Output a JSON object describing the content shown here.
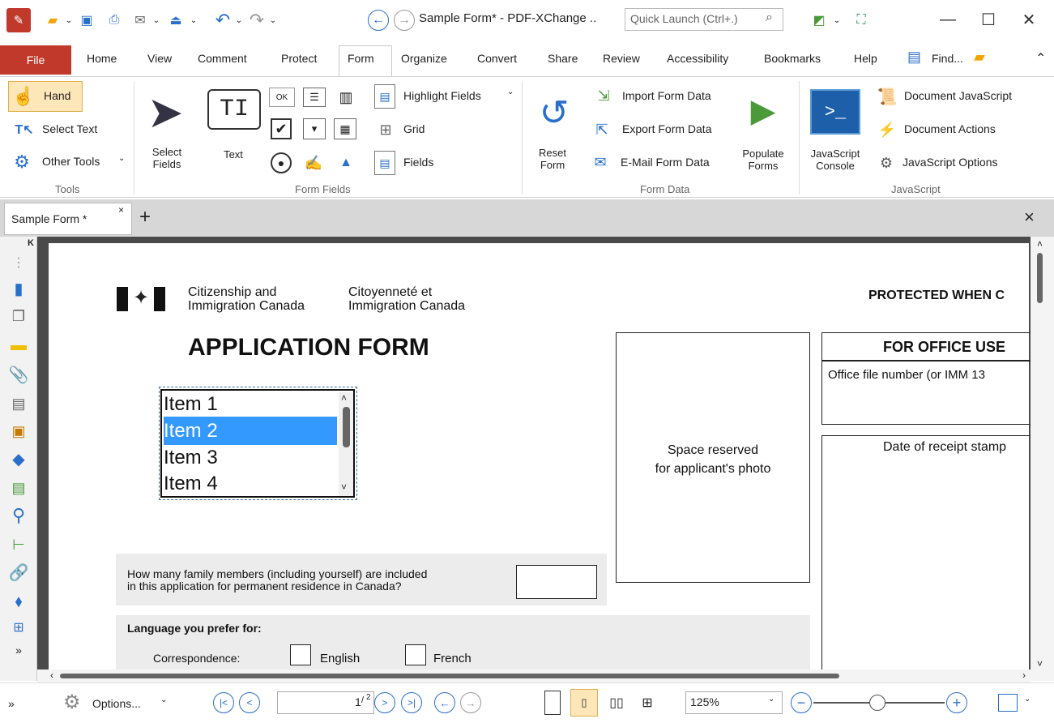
{
  "window": {
    "title": "Sample Form* - PDF-XChange ..",
    "quick_launch_placeholder": "Quick Launch (Ctrl+.)"
  },
  "menu": {
    "items": [
      "File",
      "Home",
      "View",
      "Comment",
      "Protect",
      "Form",
      "Organize",
      "Convert",
      "Share",
      "Review",
      "Accessibility",
      "Bookmarks",
      "Help"
    ],
    "find_label": "Find...",
    "active": "Form"
  },
  "ribbon": {
    "tools": {
      "hand": "Hand",
      "select_text": "Select Text",
      "other_tools": "Other Tools",
      "group": "Tools"
    },
    "form_fields": {
      "select_fields": "Select\nFields",
      "text": "Text",
      "highlight_fields": "Highlight Fields",
      "grid": "Grid",
      "fields": "Fields",
      "group": "Form Fields"
    },
    "form_data": {
      "reset_form": "Reset\nForm",
      "import": "Import Form Data",
      "export": "Export Form Data",
      "email": "E-Mail Form Data",
      "populate": "Populate\nForms",
      "group": "Form Data"
    },
    "javascript": {
      "console": "JavaScript\nConsole",
      "document_js": "Document JavaScript",
      "document_actions": "Document Actions",
      "js_options": "JavaScript Options",
      "group": "JavaScript"
    }
  },
  "doc_tab": {
    "label": "Sample Form *"
  },
  "page": {
    "dept_en": "Citizenship and\nImmigration Canada",
    "dept_fr": "Citoyenneté et\nImmigration Canada",
    "protected": "PROTECTED WHEN C",
    "title": "APPLICATION FORM",
    "listbox_items": [
      "Item 1",
      "Item 2",
      "Item 3",
      "Item 4"
    ],
    "listbox_selected": "Item 2",
    "photo_text": "Space reserved\nfor applicant's photo",
    "office_use": "FOR OFFICE USE",
    "office_file": "Office file number (or IMM 13",
    "receipt_stamp": "Date of receipt stamp",
    "family_question": "How many family members (including yourself) are included\nin this application for permanent residence in Canada?",
    "language_header": "Language you prefer for:",
    "correspondence": "Correspondence:",
    "english": "English",
    "french": "French"
  },
  "status": {
    "options": "Options...",
    "page_current": "1",
    "page_total": "2",
    "zoom": "125%"
  },
  "colors": {
    "accent": "#c0392b",
    "selection": "#3399ff"
  }
}
